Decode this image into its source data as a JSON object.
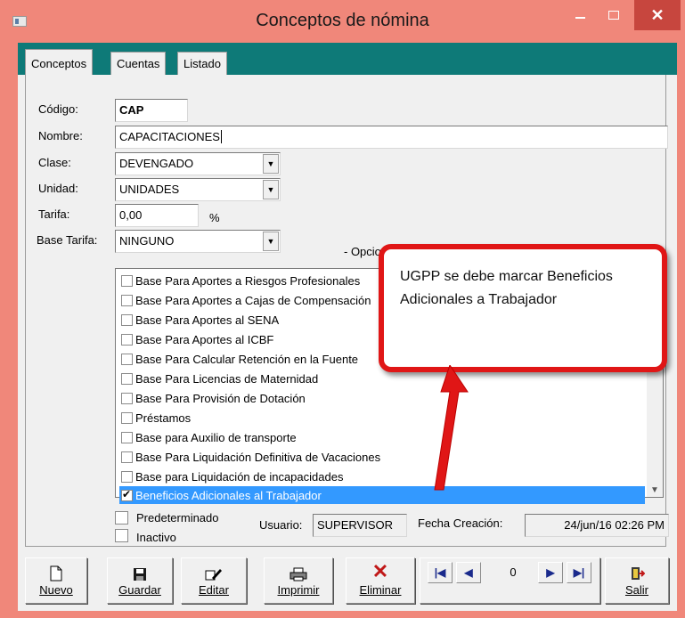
{
  "window": {
    "title": "Conceptos de nómina"
  },
  "tabs": [
    {
      "label": "Conceptos"
    },
    {
      "label": "Cuentas"
    },
    {
      "label": "Listado"
    }
  ],
  "form": {
    "codigo_label": "Código:",
    "codigo_value": "CAP",
    "nombre_label": "Nombre:",
    "nombre_value": "CAPACITACIONES",
    "clase_label": "Clase:",
    "clase_value": "DEVENGADO",
    "unidad_label": "Unidad:",
    "unidad_value": "UNIDADES",
    "tarifa_label": "Tarifa:",
    "tarifa_value": "0,00",
    "tarifa_unit": "%",
    "base_tarifa_label": "Base Tarifa:",
    "base_tarifa_value": "NINGUNO",
    "opciones_label": "- Opciones -"
  },
  "options": [
    {
      "label": "Base Para Aportes a Riesgos Profesionales",
      "checked": false
    },
    {
      "label": "Base Para Aportes a Cajas de Compensación",
      "checked": false
    },
    {
      "label": "Base Para Aportes al SENA",
      "checked": false
    },
    {
      "label": "Base Para Aportes al ICBF",
      "checked": false
    },
    {
      "label": "Base Para Calcular Retención en la Fuente",
      "checked": false
    },
    {
      "label": "Base Para Licencias de Maternidad",
      "checked": false
    },
    {
      "label": "Base Para Provisión de Dotación",
      "checked": false
    },
    {
      "label": "Préstamos",
      "checked": false
    },
    {
      "label": "Base para Auxilio de transporte",
      "checked": false
    },
    {
      "label": "Base Para Liquidación Definitiva de Vacaciones",
      "checked": false
    },
    {
      "label": "Base para Liquidación de incapacidades",
      "checked": false
    },
    {
      "label": "Beneficios Adicionales al Trabajador",
      "checked": true,
      "selected": true
    }
  ],
  "footer": {
    "predeterminado_label": "Predeterminado",
    "inactivo_label": "Inactivo",
    "usuario_label": "Usuario:",
    "usuario_value": "SUPERVISOR",
    "fecha_label": "Fecha Creación:",
    "fecha_value": "24/jun/16 02:26 PM"
  },
  "callout": {
    "text": "UGPP se debe marcar Beneficios Adicionales a Trabajador",
    "border_color": "#e01616"
  },
  "toolbar": {
    "nuevo": "Nuevo",
    "guardar": "Guardar",
    "editar": "Editar",
    "imprimir": "Imprimir",
    "eliminar": "Eliminar",
    "record": "0",
    "salir": "Salir"
  },
  "colors": {
    "titlebar": "#f0877a",
    "tabstrip": "#0e7a78",
    "selection": "#3399ff",
    "close_button": "#c7463e"
  }
}
